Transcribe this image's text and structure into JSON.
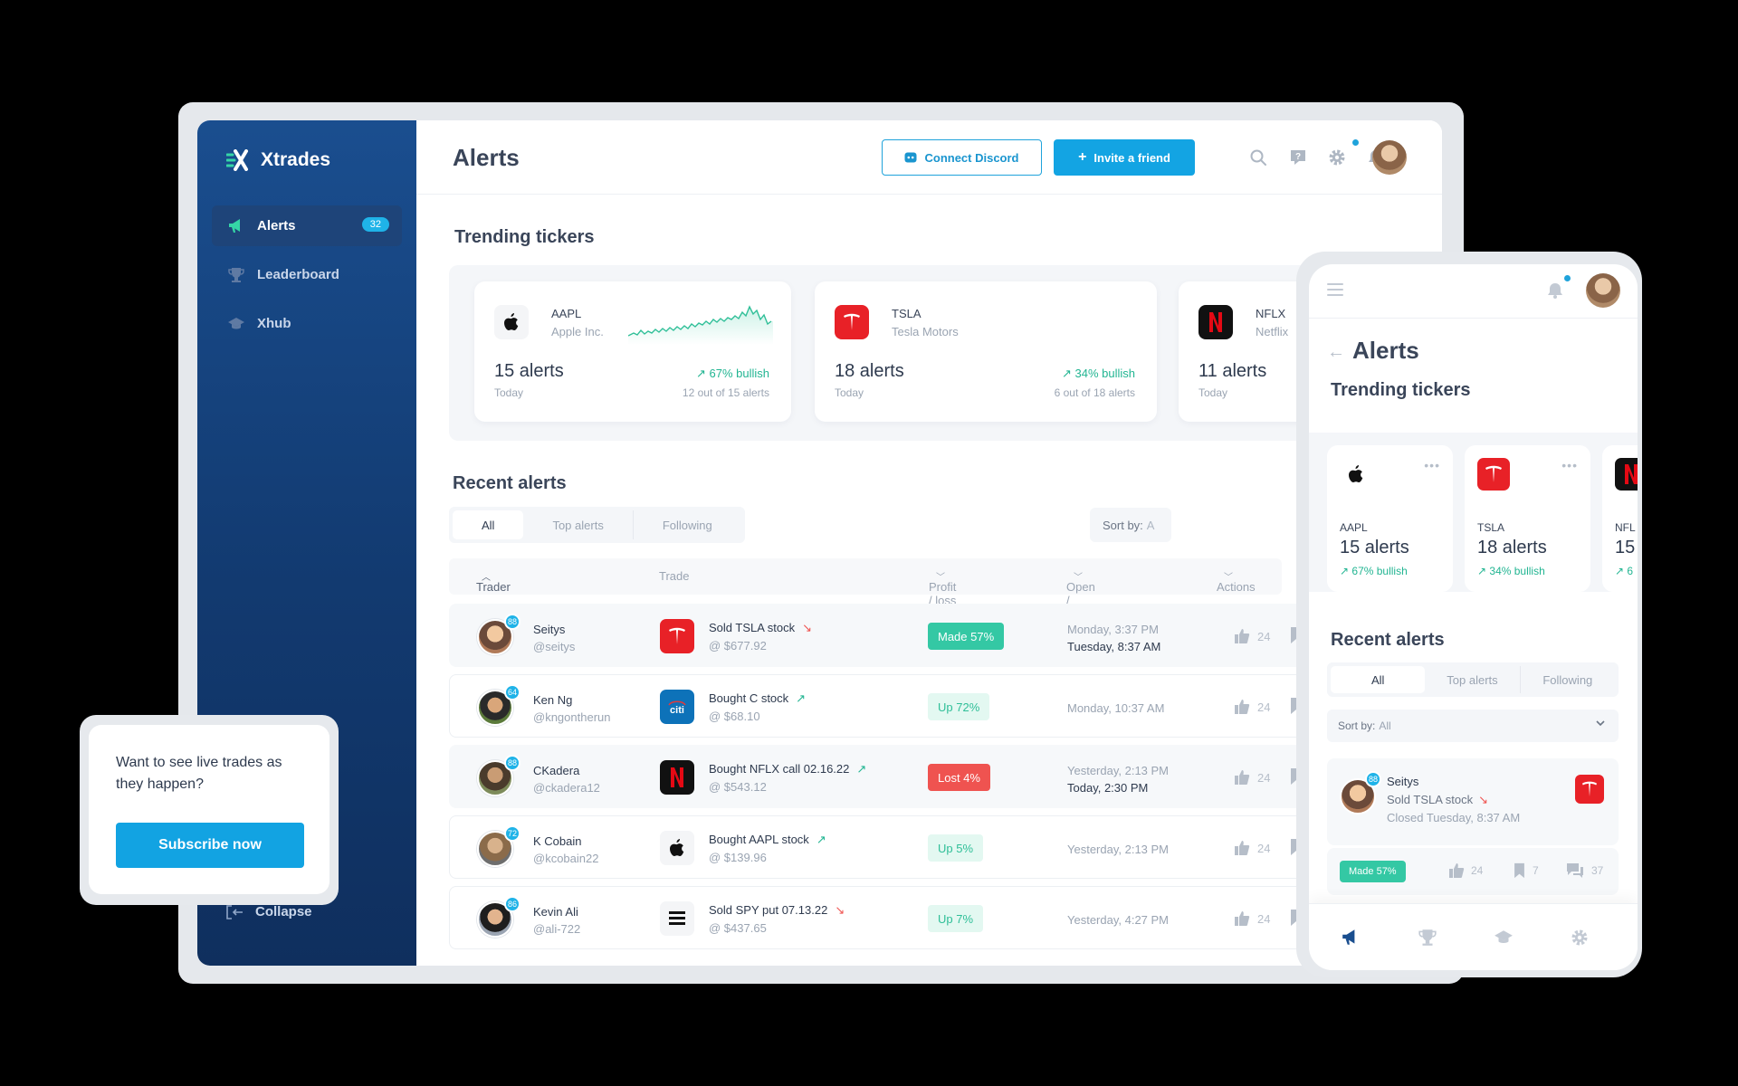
{
  "app": {
    "brand": "Xtrades",
    "title": "Alerts",
    "colors": {
      "primary": "#13a4e3",
      "sidebar": "#15427d",
      "bullish": "#22b592",
      "bearish": "#ef5350"
    }
  },
  "sidebar": {
    "items": [
      {
        "label": "Alerts",
        "icon": "megaphone-icon",
        "badge": "32",
        "active": true
      },
      {
        "label": "Leaderboard",
        "icon": "trophy-icon"
      },
      {
        "label": "Xhub",
        "icon": "graduation-cap-icon"
      }
    ],
    "collapse_label": "Collapse"
  },
  "header": {
    "discord_label": "Connect Discord",
    "invite_label": "Invite a friend",
    "icons": [
      "search-icon",
      "help-icon",
      "gear-icon",
      "bell-icon"
    ]
  },
  "trending": {
    "title": "Trending tickers",
    "tickers": [
      {
        "symbol": "AAPL",
        "name": "Apple Inc.",
        "alerts": "15 alerts",
        "period": "Today",
        "bullish": "67% bullish",
        "detail": "12 out of 15 alerts"
      },
      {
        "symbol": "TSLA",
        "name": "Tesla Motors",
        "alerts": "18 alerts",
        "period": "Today",
        "bullish": "34% bullish",
        "detail": "6 out of 18 alerts"
      },
      {
        "symbol": "NFLX",
        "name": "Netflix",
        "alerts": "11 alerts",
        "period": "Today"
      }
    ]
  },
  "recent": {
    "title": "Recent alerts",
    "tabs": [
      "All",
      "Top alerts",
      "Following"
    ],
    "sort_label": "Sort by:",
    "sort_value": "A",
    "columns": [
      "Trader",
      "Trade",
      "Profit / loss",
      "Open / close",
      "Actions"
    ],
    "rows": [
      {
        "name": "Seitys",
        "handle": "@seitys",
        "level": "88",
        "trade": "Sold TSLA stock",
        "dir": "down",
        "price": "@ $677.92",
        "result": "Made 57%",
        "result_type": "made",
        "open": "Monday, 3:37 PM",
        "close": "Tuesday, 8:37 AM",
        "likes": "24",
        "logo": "TSLA"
      },
      {
        "name": "Ken Ng",
        "handle": "@kngontherun",
        "level": "64",
        "trade": "Bought C stock",
        "dir": "up",
        "price": "@ $68.10",
        "result": "Up 72%",
        "result_type": "up",
        "open": "Monday, 10:37 AM",
        "close": "",
        "likes": "24",
        "logo": "C"
      },
      {
        "name": "CKadera",
        "handle": "@ckadera12",
        "level": "88",
        "trade": "Bought NFLX call 02.16.22",
        "dir": "up",
        "price": "@ $543.12",
        "result": "Lost 4%",
        "result_type": "lost",
        "open": "Yesterday, 2:13 PM",
        "close": "Today, 2:30 PM",
        "likes": "24",
        "logo": "NFLX"
      },
      {
        "name": "K Cobain",
        "handle": "@kcobain22",
        "level": "72",
        "trade": "Bought AAPL stock",
        "dir": "up",
        "price": "@ $139.96",
        "result": "Up 5%",
        "result_type": "up",
        "open": "Yesterday, 2:13 PM",
        "close": "",
        "likes": "24",
        "logo": "AAPL"
      },
      {
        "name": "Kevin Ali",
        "handle": "@ali-722",
        "level": "86",
        "trade": "Sold SPY put 07.13.22",
        "dir": "down",
        "price": "@ $437.65",
        "result": "Up 7%",
        "result_type": "up",
        "open": "Yesterday, 4:27 PM",
        "close": "",
        "likes": "24",
        "logo": "SPY"
      }
    ]
  },
  "promo": {
    "text": "Want to see live trades as they happen?",
    "button": "Subscribe now"
  },
  "mobile": {
    "title": "Alerts",
    "trending_title": "Trending tickers",
    "cards": [
      {
        "symbol": "AAPL",
        "alerts": "15 alerts",
        "bullish": "67% bullish"
      },
      {
        "symbol": "TSLA",
        "alerts": "18 alerts",
        "bullish": "34% bullish"
      },
      {
        "symbol": "NFL",
        "alerts": "15",
        "bullish": "6"
      }
    ],
    "recent_title": "Recent alerts",
    "tabs": [
      "All",
      "Top alerts",
      "Following"
    ],
    "sort_label": "Sort by:",
    "sort_value": "All",
    "alert": {
      "name": "Seitys",
      "trade": "Sold TSLA stock",
      "closed": "Closed Tuesday, 8:37 AM",
      "level": "88",
      "result": "Made 57%",
      "likes": "24",
      "saves": "7",
      "comments": "37"
    }
  }
}
